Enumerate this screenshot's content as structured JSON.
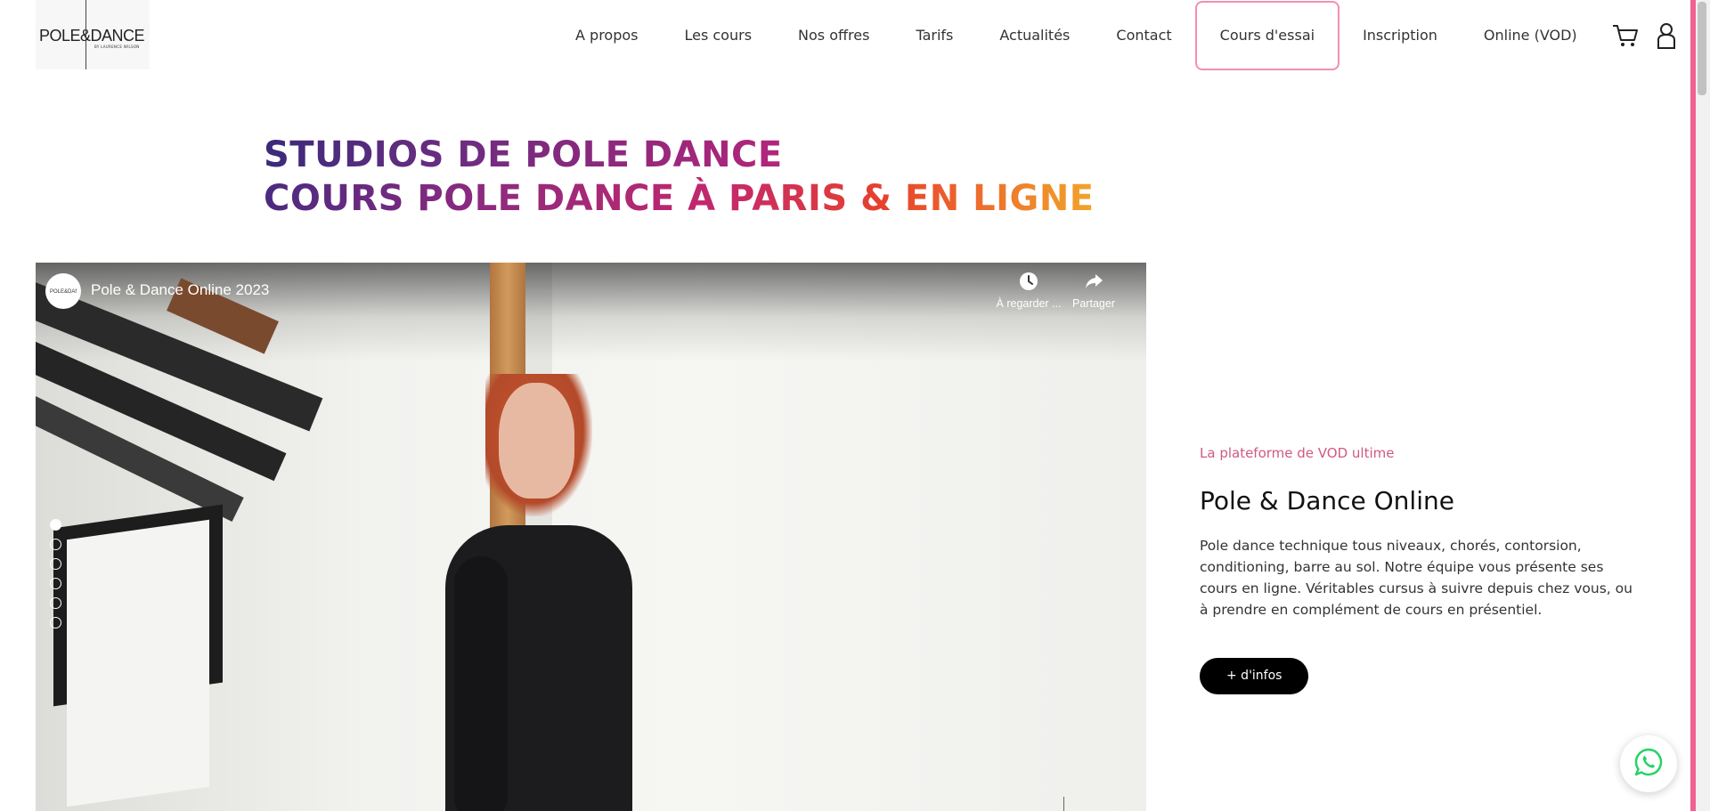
{
  "brand": {
    "logo_text": "POLE&DANCE",
    "logo_byline": "BY LAURENCE WILSON"
  },
  "nav": {
    "items": [
      {
        "label": "A propos"
      },
      {
        "label": "Les cours"
      },
      {
        "label": "Nos offres"
      },
      {
        "label": "Tarifs"
      },
      {
        "label": "Actualités"
      },
      {
        "label": "Contact"
      },
      {
        "label": "Cours d'essai"
      },
      {
        "label": "Inscription"
      },
      {
        "label": "Online (VOD)"
      }
    ],
    "icons": [
      "cart-icon",
      "user-icon"
    ]
  },
  "hero": {
    "line1": "STUDIOS DE POLE DANCE",
    "line2": "COURS POLE DANCE À PARIS & EN LIGNE"
  },
  "video": {
    "title": "Pole & Dance Online 2023",
    "watch_later": "À regarder ...",
    "share": "Partager",
    "slides_total": 6,
    "slide_active": 1
  },
  "vod": {
    "kicker": "La plateforme de VOD ultime",
    "title": "Pole & Dance Online",
    "description": "Pole dance technique tous niveaux, chorés, contorsion, conditioning, barre au sol. Notre équipe vous présente ses cours en ligne. Véritables cursus à suivre depuis chez vous, ou à prendre en complément de cours en présentiel.",
    "cta_label": "+ d'infos"
  },
  "colors": {
    "accent_pink": "#f06292",
    "kicker_pink": "#d05a7e",
    "trial_border": "#f48fb1",
    "gradient_start": "#3b2a7a",
    "gradient_end": "#f2a52a",
    "whatsapp_green": "#25d366"
  }
}
